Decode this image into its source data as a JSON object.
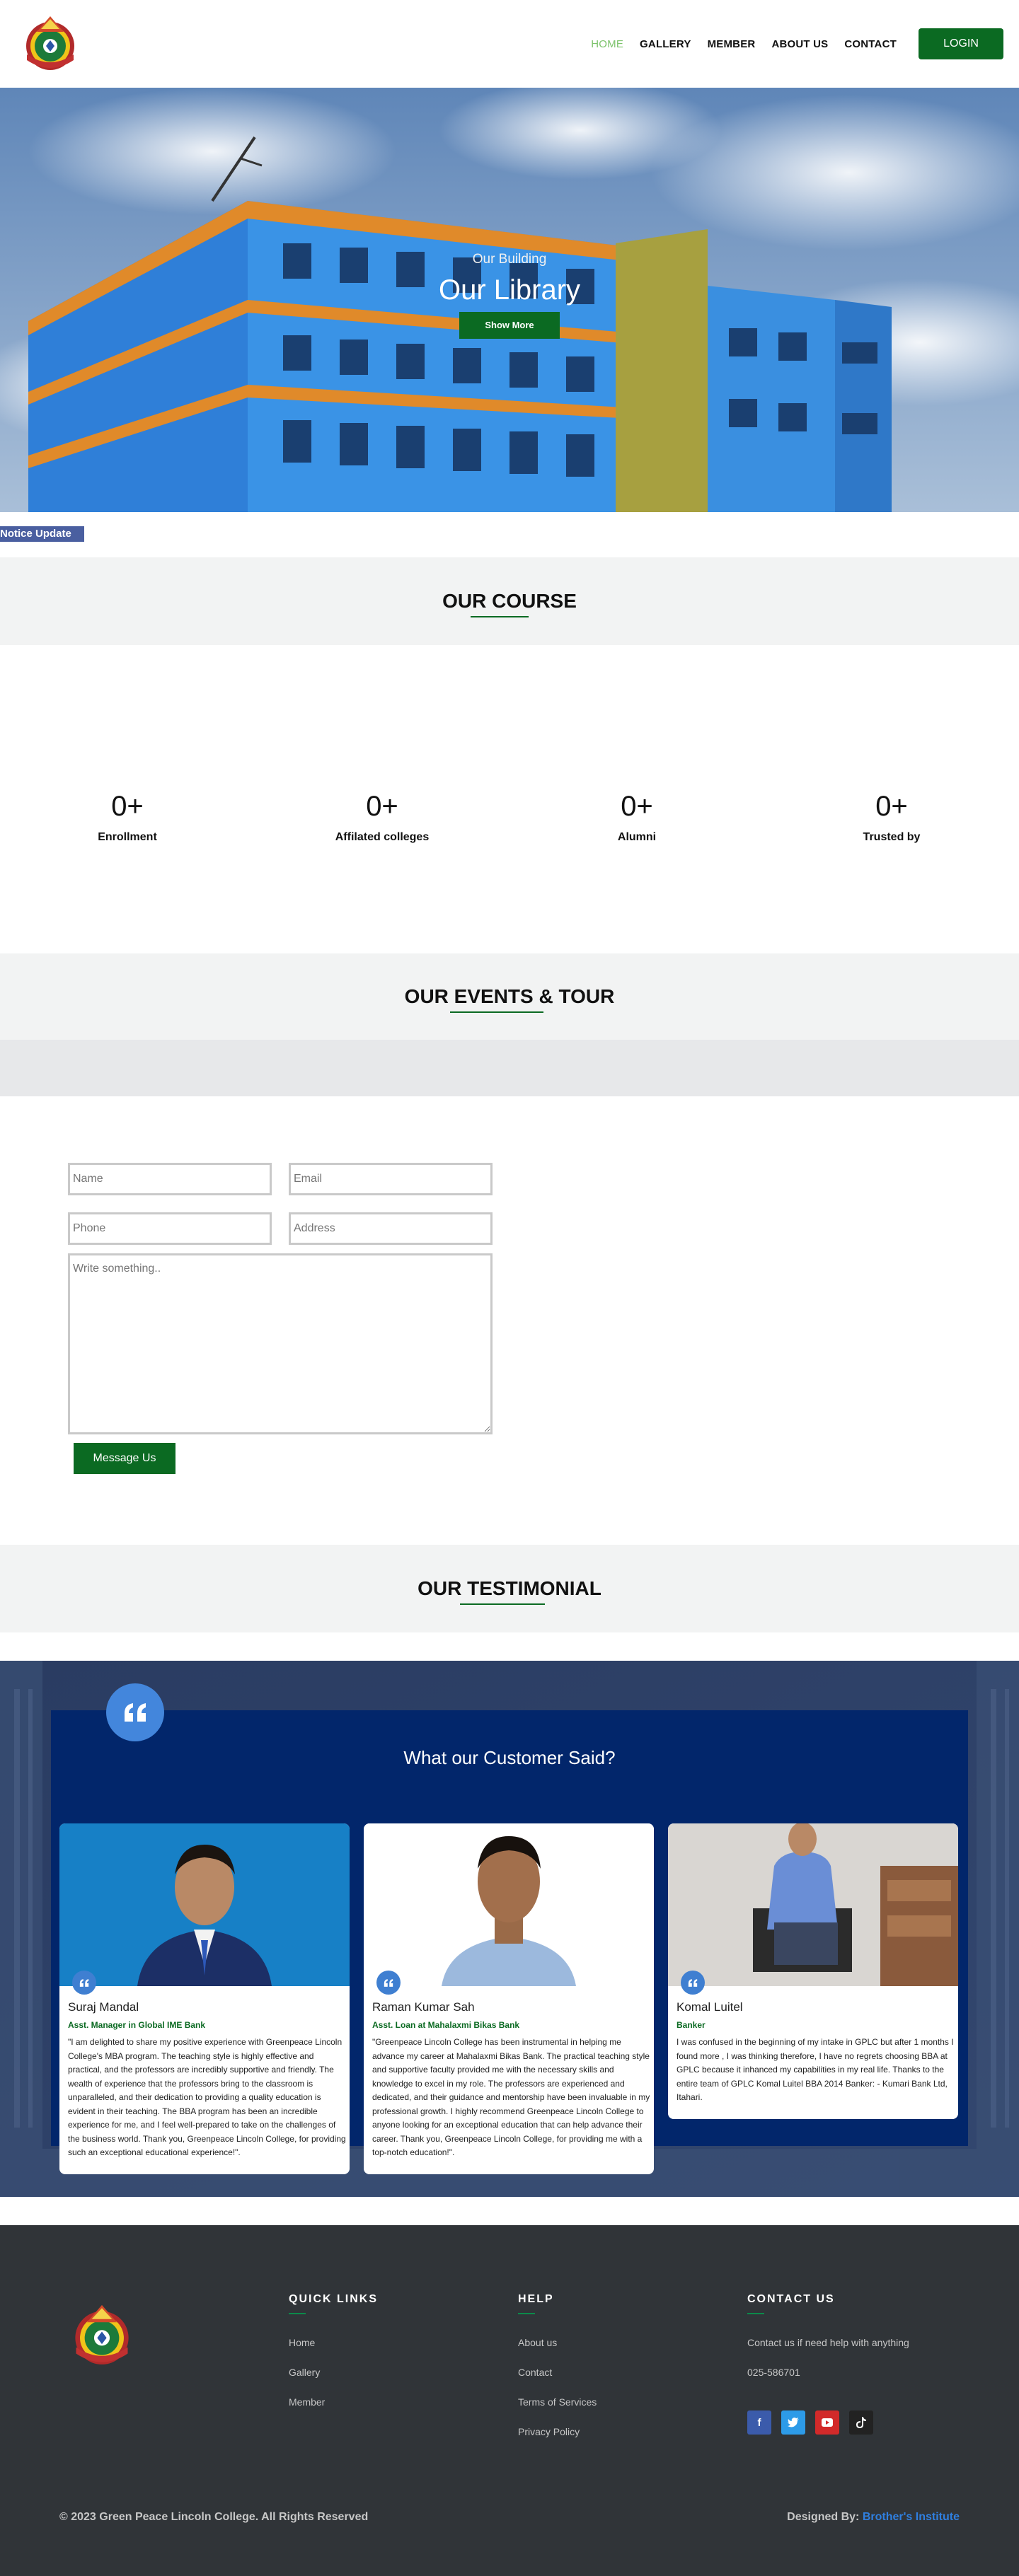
{
  "header": {
    "nav": [
      "HOME",
      "GALLERY",
      "MEMBER",
      "ABOUT US",
      "CONTACT"
    ],
    "login_label": "LOGIN"
  },
  "hero": {
    "subtitle": "Our Building",
    "title": "Our Library",
    "button_label": "Show More"
  },
  "notice": {
    "label": "Notice Update"
  },
  "courses": {
    "title_plain": "OUR ",
    "title_underlined": "COURSE"
  },
  "stats": [
    {
      "number": "0+",
      "label": "Enrollment"
    },
    {
      "number": "0+",
      "label": "Affilated colleges"
    },
    {
      "number": "0+",
      "label": "Alumni"
    },
    {
      "number": "0+",
      "label": "Trusted by"
    }
  ],
  "events": {
    "title_plain": "OUR ",
    "title_underlined": "EVENTS & ",
    "title_rest": "TOUR"
  },
  "form": {
    "name_placeholder": "Name",
    "email_placeholder": "Email",
    "phone_placeholder": "Phone",
    "address_placeholder": "Address",
    "message_placeholder": "Write something..",
    "submit_label": "Message Us"
  },
  "testimonial_section": {
    "title_plain": "OUR ",
    "title_underlined": "TESTIMONIAL"
  },
  "testimonials": {
    "heading": "What our Customer Said?",
    "items": [
      {
        "name": "Suraj Mandal",
        "role": "Asst. Manager in Global IME Bank",
        "text": "\"I am delighted to share my positive experience with Greenpeace Lincoln College's MBA program. The teaching style is highly effective and practical, and the professors are incredibly supportive and friendly. The wealth of experience that the professors bring to the classroom is unparalleled, and their dedication to providing a quality education is evident in their teaching. The BBA program has been an incredible experience for me, and I feel well-prepared to take on the challenges of the business world. Thank you, Greenpeace Lincoln College, for providing such an exceptional educational experience!\"."
      },
      {
        "name": "Raman Kumar Sah",
        "role": "Asst. Loan at Mahalaxmi Bikas Bank",
        "text": "\"Greenpeace Lincoln College has been instrumental in helping me advance my career at Mahalaxmi Bikas Bank. The practical teaching style and supportive faculty provided me with the necessary skills and knowledge to excel in my role. The professors are experienced and dedicated, and their guidance and mentorship have been invaluable in my professional growth. I highly recommend Greenpeace Lincoln College to anyone looking for an exceptional education that can help advance their career. Thank you, Greenpeace Lincoln College, for providing me with a top-notch education!\"."
      },
      {
        "name": "Komal Luitel",
        "role": "Banker",
        "text": "I was confused in the beginning of my intake in GPLC but after 1 months I found more , I was thinking therefore, I have no regrets choosing BBA at GPLC because it inhanced my capabilities in my real life. Thanks to the entire team of GPLC Komal Luitel BBA 2014 Banker: - Kumari Bank Ltd, Itahari."
      }
    ]
  },
  "footer": {
    "quick_links": {
      "title": "QUICK LINKS",
      "links": [
        "Home",
        "Gallery",
        "Member"
      ]
    },
    "help": {
      "title": "HELP",
      "links": [
        "About us",
        "Contact",
        "Terms of Services",
        "Privacy Policy"
      ]
    },
    "contact": {
      "title": "CONTACT US",
      "text": "Contact us if need help with anything",
      "phone": "025-586701"
    },
    "social_icons": [
      "facebook-icon",
      "twitter-icon",
      "youtube-icon",
      "tiktok-icon"
    ],
    "copyright": "© 2023 Green Peace Lincoln College. All Rights Reserved",
    "designed_by_label": "Designed By:",
    "designer": "Brother's Institute"
  },
  "colors": {
    "brand_green": "#0b6a22",
    "nav_active": "#7cc36b",
    "testimonial_panel": "#02266b",
    "footer_bg": "#303438",
    "designer_link": "#2f7fe0"
  }
}
